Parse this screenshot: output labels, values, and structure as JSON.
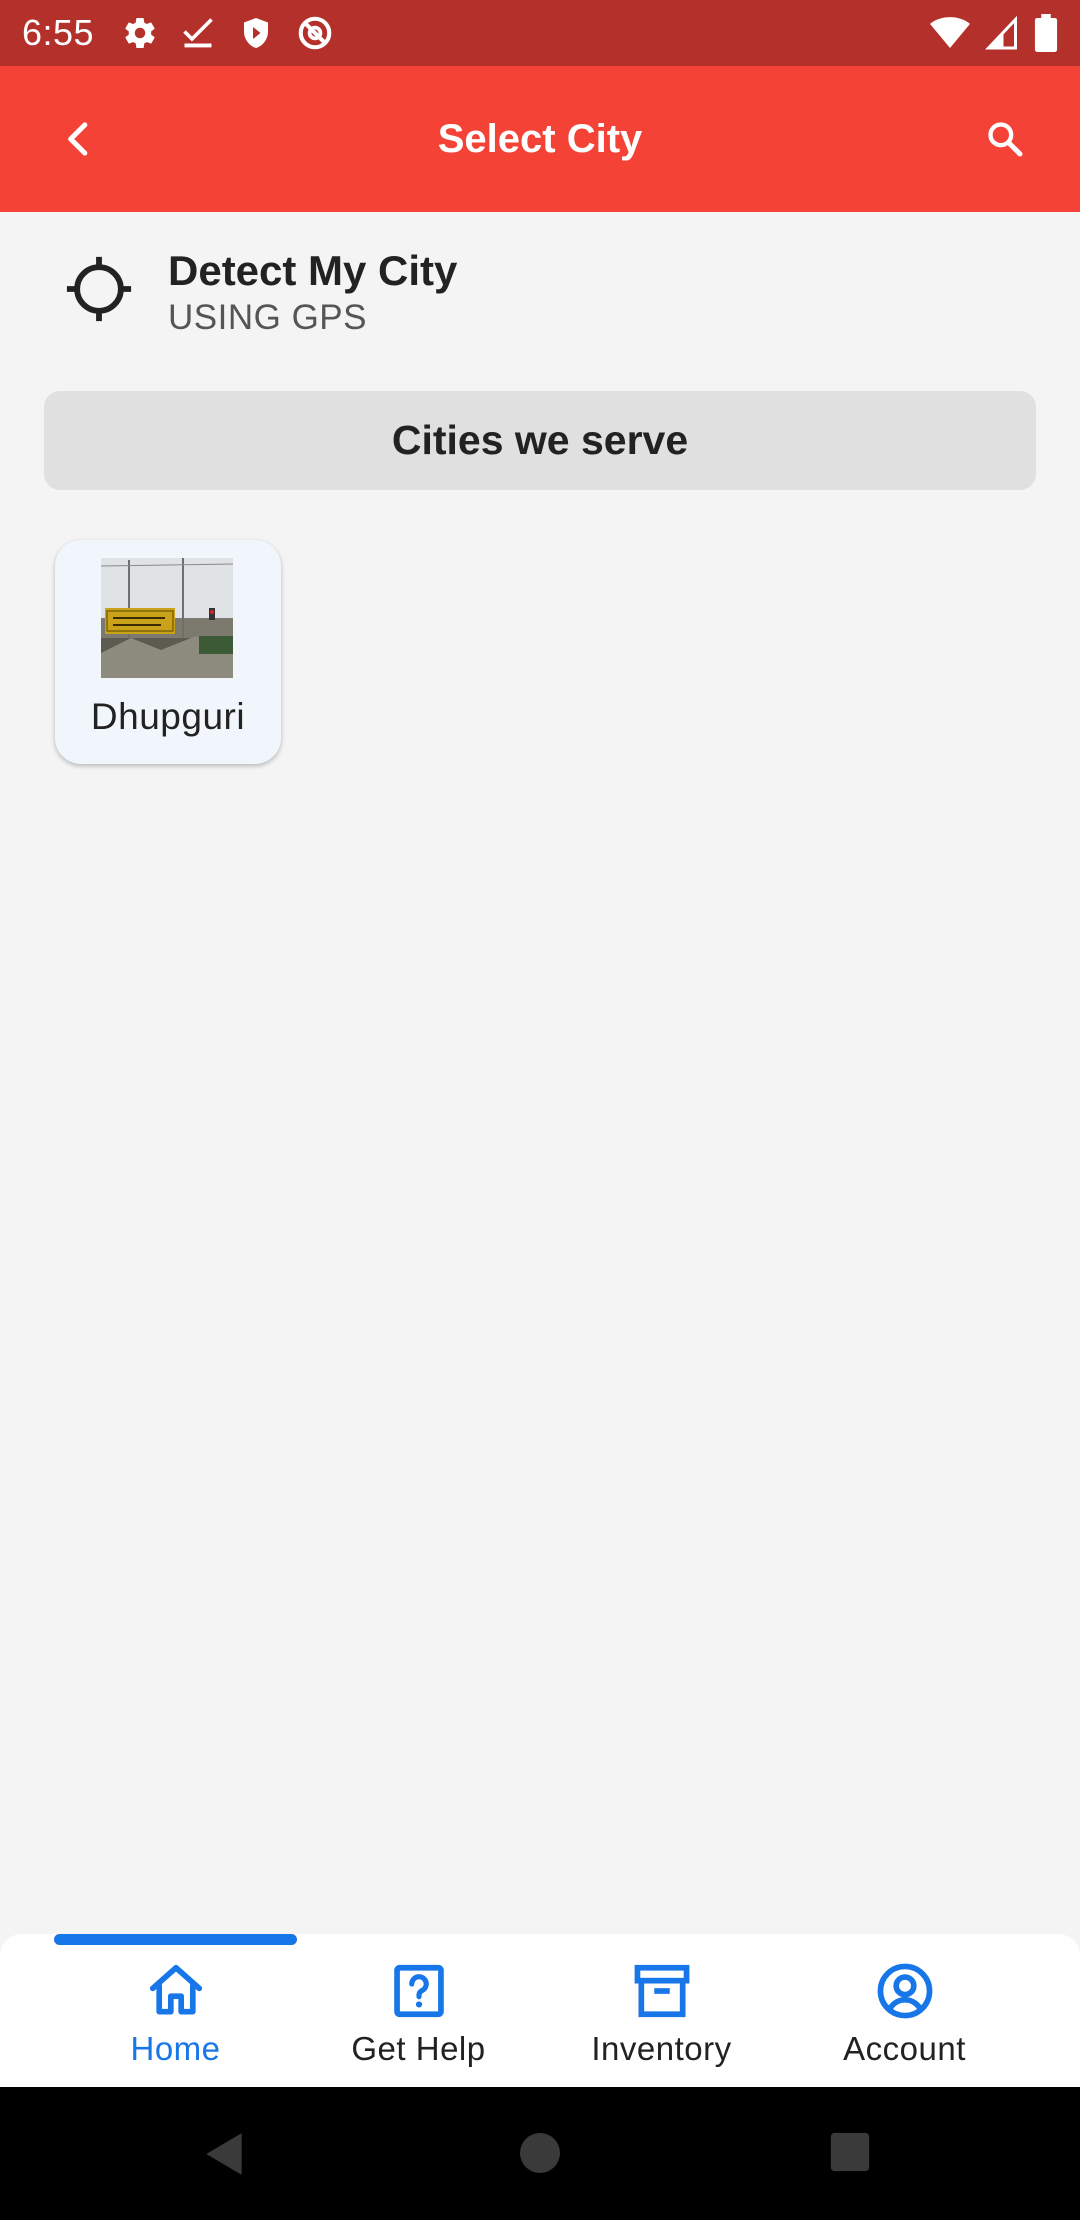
{
  "status_bar": {
    "time": "6:55"
  },
  "app_bar": {
    "title": "Select City",
    "background": "#f44336"
  },
  "detect": {
    "title": "Detect My City",
    "subtitle": "USING GPS"
  },
  "cities_header": "Cities we serve",
  "cities": [
    {
      "name": "Dhupguri"
    }
  ],
  "bottom_nav": {
    "accent": "#1877e8",
    "items": [
      {
        "label": "Home",
        "icon": "home-icon",
        "active": true
      },
      {
        "label": "Get Help",
        "icon": "help-icon",
        "active": false
      },
      {
        "label": "Inventory",
        "icon": "archive-icon",
        "active": false
      },
      {
        "label": "Account",
        "icon": "account-icon",
        "active": false
      }
    ]
  }
}
